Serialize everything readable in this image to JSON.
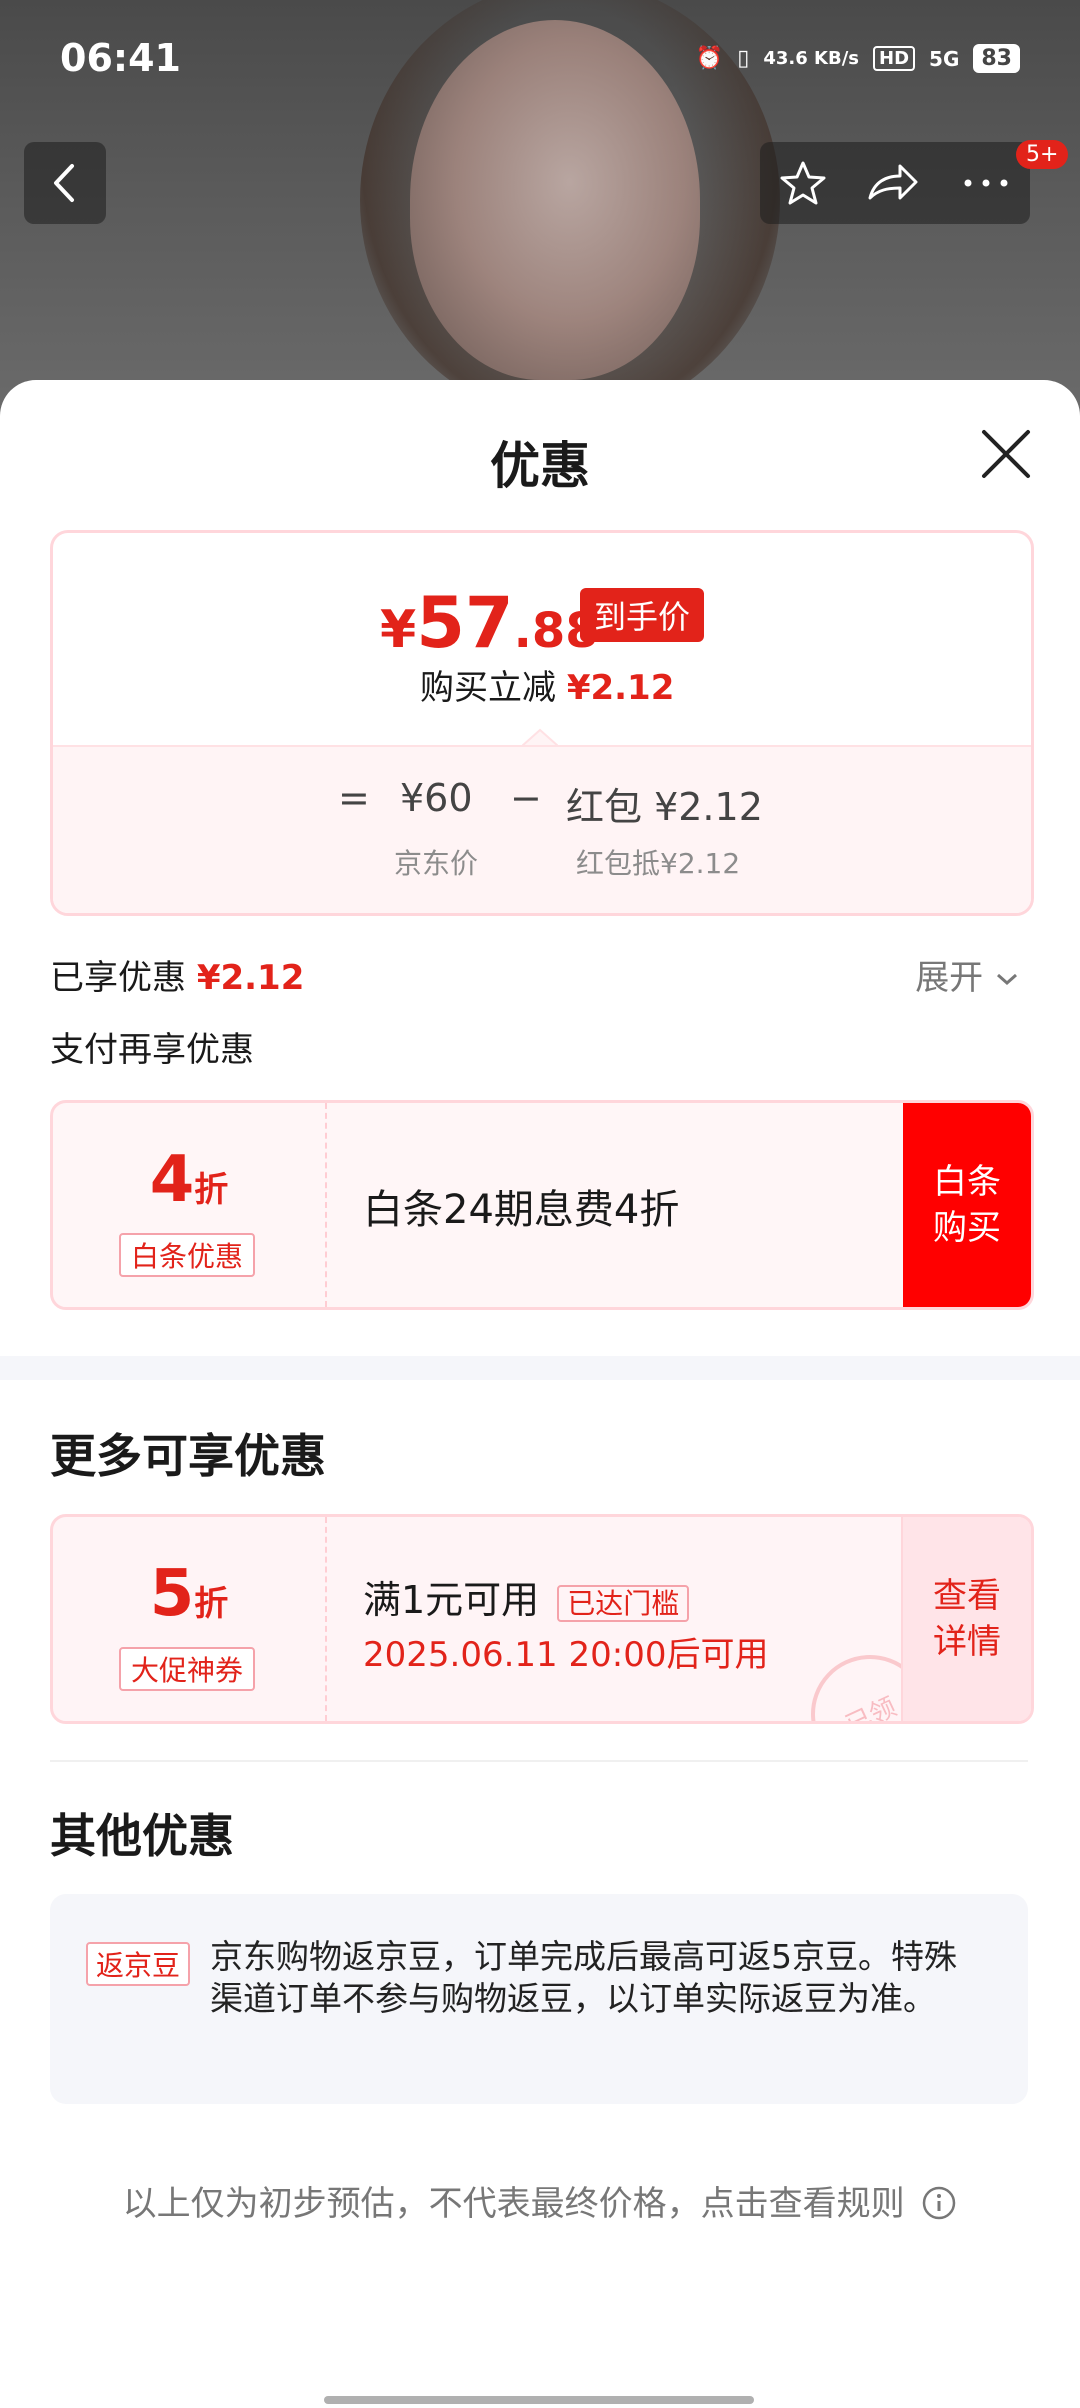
{
  "status_bar": {
    "time": "06:41",
    "net_speed": "43.6 KB/s",
    "hd": "HD",
    "signal": "5G",
    "battery": "83"
  },
  "nav": {
    "badge": "5+"
  },
  "sheet": {
    "title": "优惠"
  },
  "price": {
    "yen": "¥",
    "int": "57",
    "dec": ".88",
    "tag": "到手价",
    "reduce_label": "购买立减",
    "reduce_amount": "¥2.12",
    "eq": "=",
    "jd_price": "¥60",
    "minus": "−",
    "redpack": "红包 ¥2.12",
    "jd_price_caption": "京东价",
    "redpack_caption": "红包抵¥2.12"
  },
  "enjoyed": {
    "label": "已享优惠",
    "amount": "¥2.12",
    "expand": "展开"
  },
  "pay_more": {
    "label": "支付再享优惠"
  },
  "baitiao_coupon": {
    "num": "4",
    "unit": "折",
    "label": "白条优惠",
    "text": "白条24期息费4折",
    "action_line1": "白条",
    "action_line2": "购买"
  },
  "more": {
    "title": "更多可享优惠"
  },
  "promo_coupon": {
    "num": "5",
    "unit": "折",
    "label": "大促神券",
    "cond": "满1元可用",
    "tag": "已达门槛",
    "time": "2025.06.11 20:00后可用",
    "action_line1": "查看",
    "action_line2": "详情",
    "stamp": "已领"
  },
  "other": {
    "title": "其他优惠",
    "tag": "返京豆",
    "text": "京东购物返京豆，订单完成后最高可返5京豆。特殊渠道订单不参与购物返豆，以订单实际返豆为准。"
  },
  "footer": {
    "text": "以上仅为初步预估，不代表最终价格，点击查看规则"
  },
  "colors": {
    "accent": "#e2231a",
    "border": "#ffd6db"
  }
}
